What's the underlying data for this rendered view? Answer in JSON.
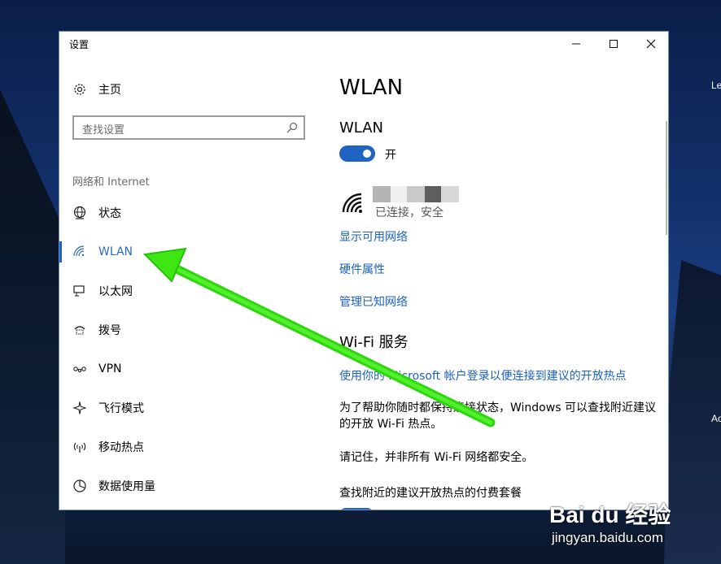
{
  "window": {
    "title": "设置"
  },
  "titlebar_buttons": {
    "minimize": "—",
    "maximize": "☐",
    "close": "✕"
  },
  "sidebar": {
    "home": "主页",
    "search_placeholder": "查找设置",
    "section": "网络和 Internet",
    "items": [
      {
        "label": "状态",
        "icon": "globe-icon"
      },
      {
        "label": "WLAN",
        "icon": "wifi-icon",
        "active": true
      },
      {
        "label": "以太网",
        "icon": "ethernet-icon"
      },
      {
        "label": "拨号",
        "icon": "dialup-icon"
      },
      {
        "label": "VPN",
        "icon": "vpn-icon"
      },
      {
        "label": "飞行模式",
        "icon": "airplane-icon"
      },
      {
        "label": "移动热点",
        "icon": "hotspot-icon"
      },
      {
        "label": "数据使用量",
        "icon": "data-usage-icon"
      }
    ]
  },
  "main": {
    "title": "WLAN",
    "wlan_heading": "WLAN",
    "toggle_state": "开",
    "network_status": "已连接，安全",
    "links": [
      "显示可用网络",
      "硬件属性",
      "管理已知网络"
    ],
    "wifi_service_heading": "Wi-Fi 服务",
    "ms_link": "使用你的 Microsoft 帐户登录以便连接到建议的开放热点",
    "para1": "为了帮助你随时都保持连接状态，Windows 可以查找附近建议的开放 Wi-Fi 热点。",
    "para2": "请记住，并非所有 Wi-Fi 网络都安全。",
    "para3": "查找附近的建议开放热点的付费套餐"
  },
  "desktop": {
    "label1": "Le",
    "label2": "Ac"
  },
  "watermark": {
    "logo": "Bai du 经验",
    "url": "jingyan.baidu.com"
  },
  "colors": {
    "accent": "#1f63c3",
    "link": "#1b61c1",
    "arrow": "#3ee614"
  }
}
